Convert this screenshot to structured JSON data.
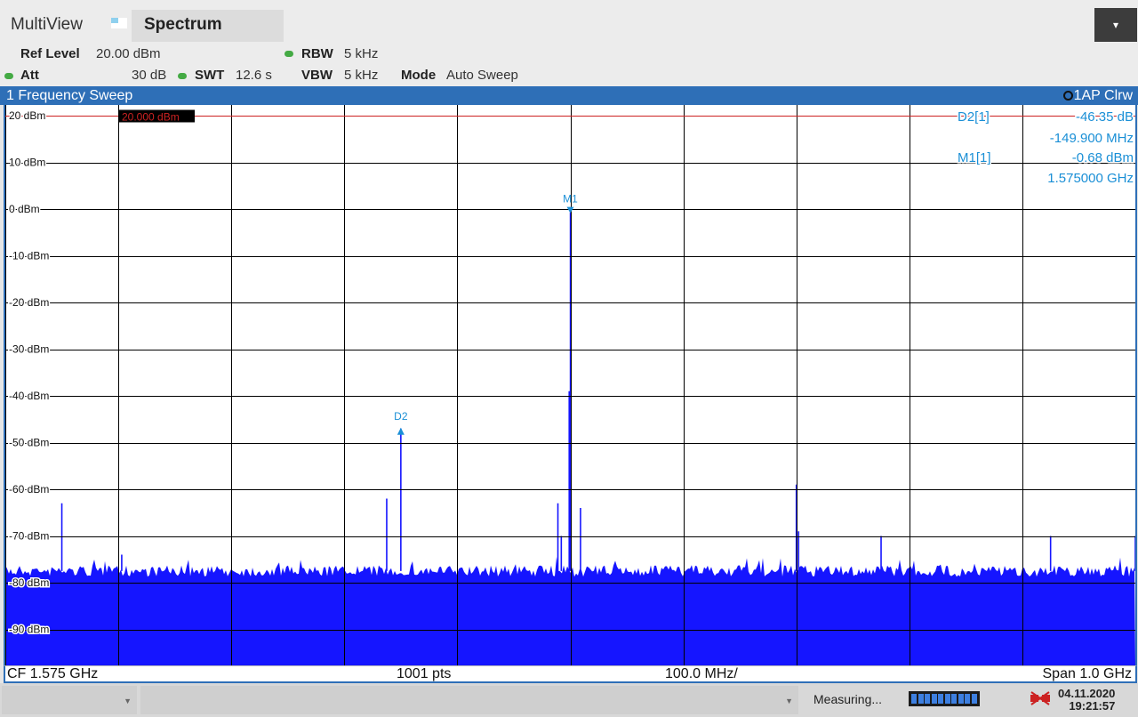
{
  "header": {
    "app_label": "MultiView",
    "tab_label": "Spectrum",
    "menu_icon": "chevron-down-icon"
  },
  "settings": {
    "ref_level_key": "Ref Level",
    "ref_level_val": "20.00 dBm",
    "att_key": "Att",
    "att_val": "30 dB",
    "rbw_key": "RBW",
    "rbw_val": "5 kHz",
    "swt_key": "SWT",
    "swt_val": "12.6 s",
    "vbw_key": "VBW",
    "vbw_val": "5 kHz",
    "mode_key": "Mode",
    "mode_val": "Auto Sweep"
  },
  "window": {
    "title": "1 Frequency Sweep",
    "trace_label": "1AP Clrw"
  },
  "chart_data": {
    "type": "line",
    "ylabel_unit": "dBm",
    "ylim": [
      -100,
      20
    ],
    "y_ticks": [
      "20 dBm",
      "10 dBm",
      "0 dBm",
      "-10 dBm",
      "-20 dBm",
      "-30 dBm",
      "-40 dBm",
      "-50 dBm",
      "-60 dBm",
      "-70 dBm",
      "-80 dBm",
      "-90 dBm"
    ],
    "y_tick_values": [
      20,
      10,
      0,
      -10,
      -20,
      -30,
      -40,
      -50,
      -60,
      -70,
      -80,
      -90
    ],
    "xlim_ghz": [
      1.075,
      2.075
    ],
    "ref_line_label": "20.000 dBm",
    "ref_line_value": 20,
    "noise_floor_dbm": -77.5,
    "peaks": [
      {
        "x_ghz": 1.125,
        "y": -63
      },
      {
        "x_ghz": 1.178,
        "y": -74
      },
      {
        "x_ghz": 1.4125,
        "y": -62
      },
      {
        "x_ghz": 1.425,
        "y": -47
      },
      {
        "x_ghz": 1.564,
        "y": -63
      },
      {
        "x_ghz": 1.567,
        "y": -70
      },
      {
        "x_ghz": 1.574,
        "y": -39
      },
      {
        "x_ghz": 1.575,
        "y": -0.68
      },
      {
        "x_ghz": 1.584,
        "y": -64
      },
      {
        "x_ghz": 1.775,
        "y": -59
      },
      {
        "x_ghz": 1.777,
        "y": -69
      },
      {
        "x_ghz": 1.85,
        "y": -70
      },
      {
        "x_ghz": 2.0,
        "y": -70
      },
      {
        "x_ghz": 2.075,
        "y": -70
      }
    ],
    "markers": [
      {
        "label": "M1",
        "x_ghz": 1.575,
        "y": -0.68
      },
      {
        "label": "D2",
        "x_ghz": 1.425,
        "y": -47
      }
    ],
    "marker_table": [
      {
        "name": "D2[1]",
        "value": "-46.35 dB",
        "freq": "-149.900 MHz"
      },
      {
        "name": "M1[1]",
        "value": "-0.68 dBm",
        "freq": "1.575000 GHz"
      }
    ],
    "colors": {
      "trace": "#1515ff",
      "marker": "#1a8fd6",
      "ref_line": "#cc2222",
      "grid": "#000000"
    }
  },
  "footer": {
    "cf": "CF 1.575 GHz",
    "pts": "1001 pts",
    "div": "100.0 MHz/",
    "span": "Span 1.0 GHz"
  },
  "status": {
    "measuring": "Measuring...",
    "date": "04.11.2020",
    "time": "19:21:57"
  }
}
